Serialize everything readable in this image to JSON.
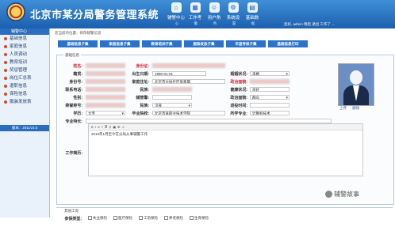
{
  "header": {
    "title": "北京市某分局警务管理系统",
    "nav": [
      {
        "icon": "home-icon",
        "label": "辅警中心"
      },
      {
        "icon": "workbench-icon",
        "label": "工作考"
      },
      {
        "icon": "users-icon",
        "label": "用户角"
      },
      {
        "icon": "settings-icon",
        "label": "系统设"
      },
      {
        "icon": "data-icon",
        "label": "基础数"
      }
    ],
    "subnav": [
      "心",
      "勤",
      "色",
      "置",
      "据"
    ],
    "user_text": "您好, admin  稍后 退出 工作了 ..."
  },
  "sidebar": {
    "title": "辅警中心",
    "items": [
      "基础信息",
      "家庭信息",
      "人员调动",
      "教育培训",
      "奖惩管理",
      "岗位汇总表",
      "退职信息",
      "保险信息",
      "服装发放表"
    ],
    "version": "版本：2011V2.0"
  },
  "main": {
    "breadcrumb": "您当前的位置：修改辅警信息",
    "tabs": [
      "基础信息子集",
      "家庭信息子集",
      "教育培训子集",
      "服装发放子集",
      "年度考核子集",
      "基础信息打印"
    ],
    "basic": {
      "legend": "基础信息",
      "labels": {
        "name": "姓名:",
        "idno": "身份证:",
        "birth": "出生日期:",
        "marital": "婚姻状况:",
        "native": "籍贯:",
        "address": "家庭住址:",
        "politics": "政治面貌:",
        "healthy": "健康状况:",
        "id": "身份号:",
        "health_st": "健康状况:",
        "tel": "联系电话:",
        "ethnicity": "民族:",
        "assist_mgr": "辅管警:",
        "gender": "性别:",
        "honorable": "荣誉称号:",
        "enlist": "退役时间:",
        "education": "学历:",
        "grad_school": "毕业院校:",
        "major": "所学专业:",
        "specialty": "专业特长:",
        "work_history": "工作简历:"
      },
      "values": {
        "birth": "1990-01-01",
        "marital": "未婚",
        "address": "北京市分局社区某家属",
        "health": "良好",
        "politics": "群众",
        "ethnicity": "汉族",
        "education": "大专",
        "grad_school": "北京市某职业技术学院",
        "major": "计算机技术"
      },
      "photo_links": [
        "上传",
        "删除"
      ],
      "editor_text": "2016年1月至今在分局从事辅警工作"
    },
    "insurance": {
      "legend": "参保类型",
      "label": "参保类型:",
      "options": [
        "失业保险",
        "医疗保险",
        "工伤保险",
        "养老保险",
        "生育保险"
      ]
    },
    "bottom_legend": "其他工资"
  },
  "watermark": "辅警故事"
}
